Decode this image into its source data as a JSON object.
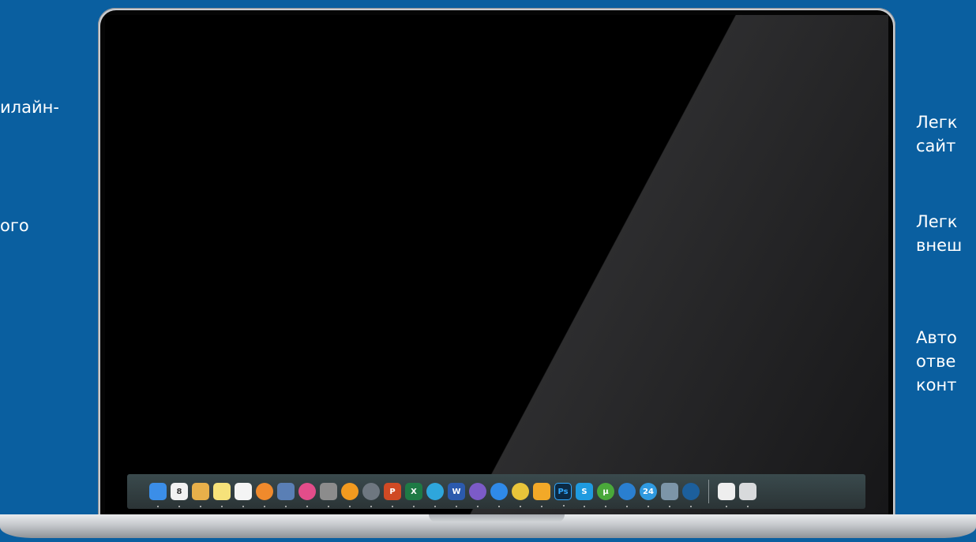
{
  "left_texts": [
    {
      "lines": [
        "илайн-"
      ]
    },
    {
      "lines": [
        "ого"
      ]
    }
  ],
  "right_texts": [
    {
      "lines": [
        "Легк",
        "сайт"
      ]
    },
    {
      "lines": [
        "Легк",
        "внеш"
      ]
    },
    {
      "lines": [
        "Авто",
        "отве",
        "конт"
      ]
    }
  ],
  "dock": {
    "icons": [
      {
        "name": "finder-icon",
        "label": "",
        "color": "#3b8ee8",
        "round": false
      },
      {
        "name": "calendar-icon",
        "label": "8",
        "color": "#f2f2f2",
        "round": false
      },
      {
        "name": "textedit-icon",
        "label": "",
        "color": "#e8b04a",
        "round": false
      },
      {
        "name": "notes-icon",
        "label": "",
        "color": "#f6e27a",
        "round": false
      },
      {
        "name": "reminders-icon",
        "label": "",
        "color": "#f4f4f4",
        "round": false
      },
      {
        "name": "photos-icon",
        "label": "",
        "color": "#f08a2c",
        "round": true
      },
      {
        "name": "preview-icon",
        "label": "",
        "color": "#5a7fb5",
        "round": false
      },
      {
        "name": "itunes-icon",
        "label": "",
        "color": "#e34d8a",
        "round": true
      },
      {
        "name": "system-preferences-icon",
        "label": "",
        "color": "#8c8c8c",
        "round": false
      },
      {
        "name": "ibooks-icon",
        "label": "",
        "color": "#f29a1f",
        "round": true
      },
      {
        "name": "launchpad-icon",
        "label": "",
        "color": "#6e7780",
        "round": true
      },
      {
        "name": "powerpoint-icon",
        "label": "P",
        "color": "#d04a24",
        "round": false
      },
      {
        "name": "excel-icon",
        "label": "X",
        "color": "#1e7a45",
        "round": false
      },
      {
        "name": "telegram-icon",
        "label": "",
        "color": "#2ea6dc",
        "round": true
      },
      {
        "name": "word-icon",
        "label": "W",
        "color": "#2b5aad",
        "round": false
      },
      {
        "name": "viber-icon",
        "label": "",
        "color": "#7c5bc7",
        "round": true
      },
      {
        "name": "safari-icon",
        "label": "",
        "color": "#2f8ae8",
        "round": true
      },
      {
        "name": "chrome-icon",
        "label": "",
        "color": "#e8c43a",
        "round": true
      },
      {
        "name": "sketch-icon",
        "label": "",
        "color": "#f2a928",
        "round": false
      },
      {
        "name": "photoshop-icon",
        "label": "Ps",
        "color": "#0c2a44",
        "round": false
      },
      {
        "name": "skype-icon",
        "label": "S",
        "color": "#1f9be0",
        "round": false
      },
      {
        "name": "utorrent-icon",
        "label": "μ",
        "color": "#4aa83a",
        "round": true
      },
      {
        "name": "quicktime-icon",
        "label": "",
        "color": "#2a7fd0",
        "round": true
      },
      {
        "name": "24-icon",
        "label": "24",
        "color": "#2f9ae0",
        "round": true
      },
      {
        "name": "image-capture-icon",
        "label": "",
        "color": "#7c95a8",
        "round": false
      },
      {
        "name": "app-icon",
        "label": "",
        "color": "#1c5f9c",
        "round": true
      }
    ],
    "trailing_icons": [
      {
        "name": "downloads-stack-icon",
        "label": "",
        "color": "#eeeeee",
        "round": false
      },
      {
        "name": "trash-icon",
        "label": "",
        "color": "#d8dadc",
        "round": false
      }
    ]
  }
}
